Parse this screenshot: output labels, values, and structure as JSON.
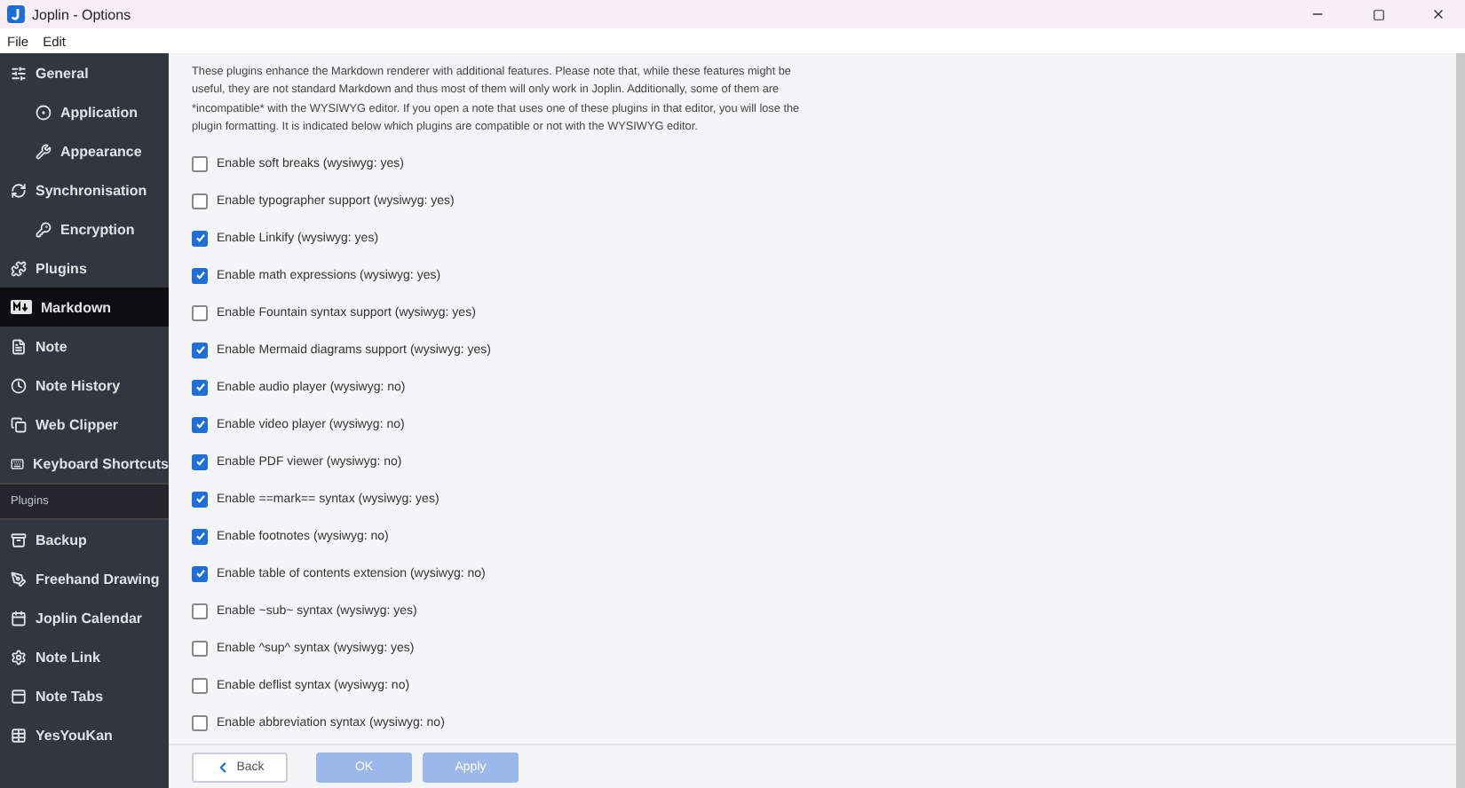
{
  "window": {
    "title": "Joplin - Options"
  },
  "menu": [
    "File",
    "Edit"
  ],
  "sidebar": {
    "items": [
      {
        "kind": "page",
        "label": "General",
        "selected": false,
        "children": [
          {
            "kind": "page",
            "label": "Application",
            "selected": false
          },
          {
            "kind": "page",
            "label": "Appearance",
            "selected": false
          }
        ]
      },
      {
        "kind": "page",
        "label": "Synchronisation",
        "selected": false,
        "children": [
          {
            "kind": "page",
            "label": "Encryption",
            "selected": false
          }
        ]
      },
      {
        "kind": "page",
        "label": "Plugins",
        "selected": false
      },
      {
        "kind": "page",
        "label": "Markdown",
        "selected": true
      },
      {
        "kind": "page",
        "label": "Note",
        "selected": false
      },
      {
        "kind": "page",
        "label": "Note History",
        "selected": false
      },
      {
        "kind": "page",
        "label": "Web Clipper",
        "selected": false
      },
      {
        "kind": "page",
        "label": "Keyboard Shortcuts",
        "selected": false
      },
      {
        "kind": "header",
        "label": "Plugins"
      },
      {
        "kind": "page",
        "label": "Backup",
        "selected": false
      },
      {
        "kind": "page",
        "label": "Freehand Drawing",
        "selected": false
      },
      {
        "kind": "page",
        "label": "Joplin Calendar",
        "selected": false
      },
      {
        "kind": "page",
        "label": "Note Link",
        "selected": false
      },
      {
        "kind": "page",
        "label": "Note Tabs",
        "selected": false
      },
      {
        "kind": "page",
        "label": "YesYouKan",
        "selected": false
      }
    ]
  },
  "description": "These plugins enhance the Markdown renderer with additional features. Please note that, while these features might be useful, they are not standard Markdown and thus most of them will only work in Joplin. Additionally, some of them are *incompatible* with the WYSIWYG editor. If you open a note that uses one of these plugins in that editor, you will lose the plugin formatting. It is indicated below which plugins are compatible or not with the WYSIWYG editor.",
  "options": [
    {
      "label": "Enable soft breaks (wysiwyg: yes)",
      "checked": false
    },
    {
      "label": "Enable typographer support (wysiwyg: yes)",
      "checked": false
    },
    {
      "label": "Enable Linkify (wysiwyg: yes)",
      "checked": true
    },
    {
      "label": "Enable math expressions (wysiwyg: yes)",
      "checked": true
    },
    {
      "label": "Enable Fountain syntax support (wysiwyg: yes)",
      "checked": false
    },
    {
      "label": "Enable Mermaid diagrams support (wysiwyg: yes)",
      "checked": true
    },
    {
      "label": "Enable audio player (wysiwyg: no)",
      "checked": true
    },
    {
      "label": "Enable video player (wysiwyg: no)",
      "checked": true
    },
    {
      "label": "Enable PDF viewer (wysiwyg: no)",
      "checked": true
    },
    {
      "label": "Enable ==mark== syntax (wysiwyg: yes)",
      "checked": true
    },
    {
      "label": "Enable footnotes (wysiwyg: no)",
      "checked": true
    },
    {
      "label": "Enable table of contents extension (wysiwyg: no)",
      "checked": true
    },
    {
      "label": "Enable ~sub~ syntax (wysiwyg: yes)",
      "checked": false
    },
    {
      "label": "Enable ^sup^ syntax (wysiwyg: yes)",
      "checked": false
    },
    {
      "label": "Enable deflist syntax (wysiwyg: no)",
      "checked": false
    },
    {
      "label": "Enable abbreviation syntax (wysiwyg: no)",
      "checked": false
    }
  ],
  "buttons": [
    {
      "kind": "back",
      "label": "Back",
      "disabled": false
    },
    {
      "kind": "primary",
      "label": "OK",
      "disabled": true
    },
    {
      "kind": "primary",
      "label": "Apply",
      "disabled": true
    }
  ]
}
